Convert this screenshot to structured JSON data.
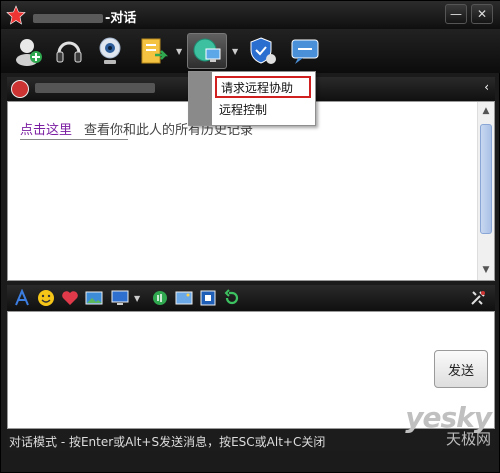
{
  "window": {
    "title_suffix": "-对话",
    "minimize_label": "—",
    "close_label": "✕"
  },
  "toolbar": {
    "items": [
      {
        "name": "add-contact-icon"
      },
      {
        "name": "headset-icon"
      },
      {
        "name": "webcam-icon"
      },
      {
        "name": "send-file-icon"
      },
      {
        "name": "remote-assist-icon"
      },
      {
        "name": "security-icon"
      },
      {
        "name": "chat-bubble-icon"
      }
    ],
    "dropdown_arrow": "▼"
  },
  "contact_bar": {
    "collapse_label": "‹"
  },
  "history": {
    "link_text": "点击这里",
    "info_text": "查看你和此人的所有历史记录"
  },
  "menu": {
    "items": [
      {
        "label": "请求远程协助"
      },
      {
        "label": "远程控制"
      }
    ]
  },
  "input": {
    "send_label": "发送",
    "tools": [
      "font-icon",
      "smiley-icon",
      "heart-icon",
      "image-icon",
      "screenshot-icon",
      "voice-icon",
      "picture-icon",
      "grab-icon",
      "refresh-icon",
      "settings-icon"
    ]
  },
  "status": {
    "text": "对话模式 - 按Enter或Alt+S发送消息，按ESC或Alt+C关闭"
  },
  "watermark": {
    "brand": "yesky",
    "cn": "天极网"
  },
  "colors": {
    "accent": "#7b1fa2",
    "menu_highlight": "#d02020"
  }
}
